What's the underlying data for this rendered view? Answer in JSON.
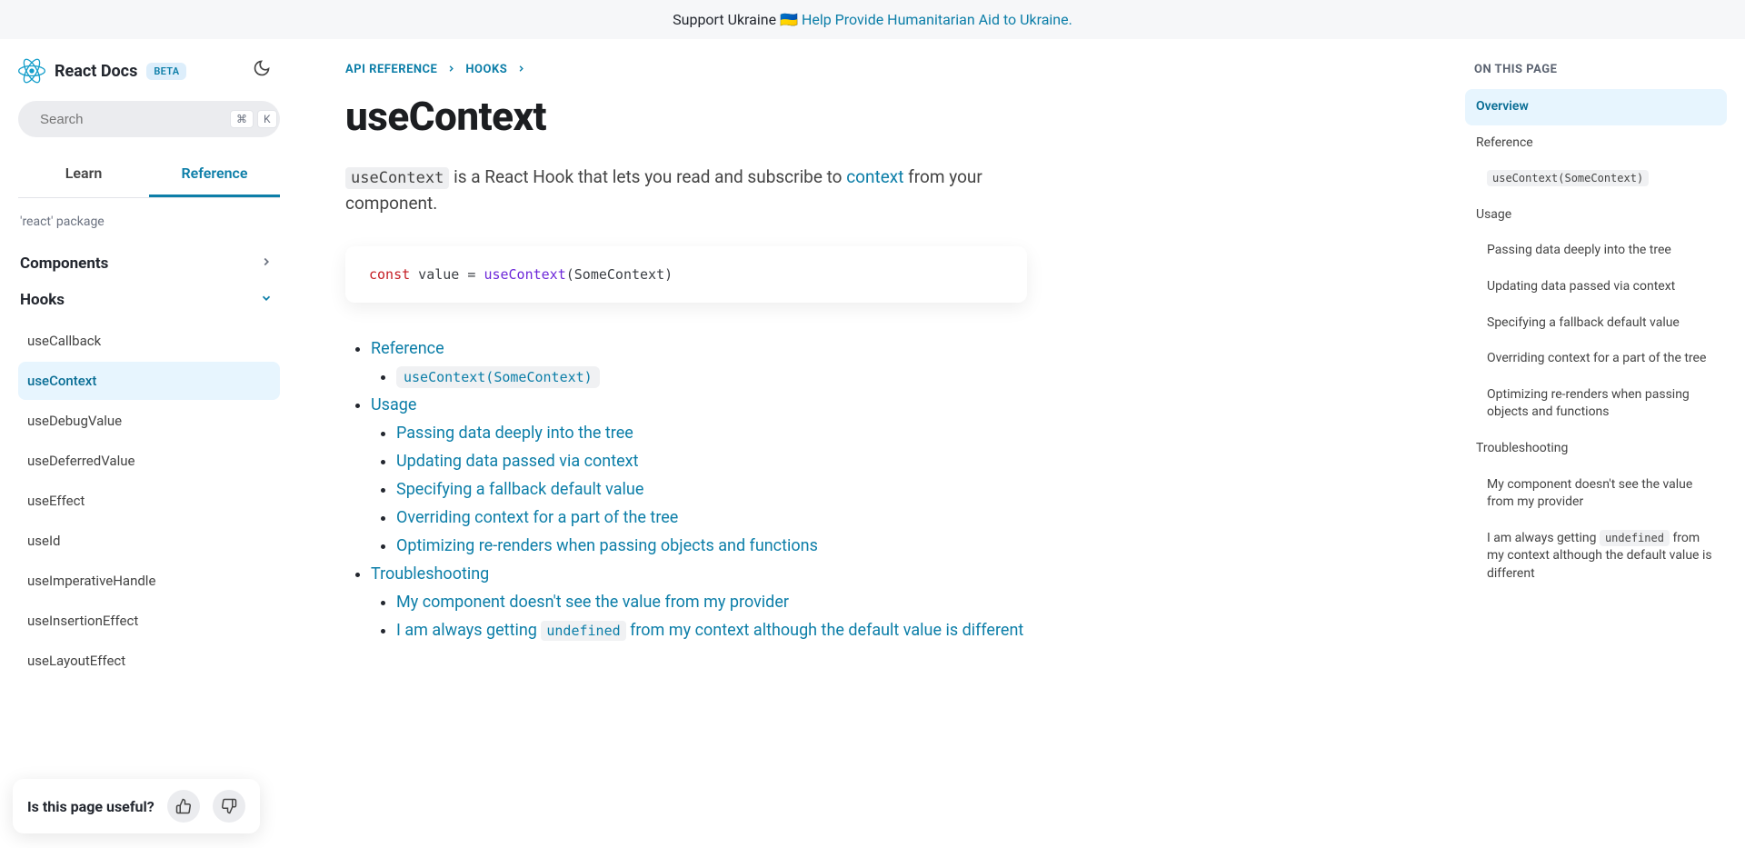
{
  "banner": {
    "text_prefix": "Support Ukraine 🇺🇦 ",
    "link_text": "Help Provide Humanitarian Aid to Ukraine."
  },
  "header": {
    "logo_text": "React Docs",
    "beta_label": "BETA",
    "search_placeholder": "Search",
    "kbd1": "⌘",
    "kbd2": "K"
  },
  "tabs": {
    "learn": "Learn",
    "reference": "Reference"
  },
  "sidebar": {
    "package_label": "'react' package",
    "section_components": "Components",
    "section_hooks": "Hooks",
    "items": [
      "useCallback",
      "useContext",
      "useDebugValue",
      "useDeferredValue",
      "useEffect",
      "useId",
      "useImperativeHandle",
      "useInsertionEffect",
      "useLayoutEffect"
    ]
  },
  "feedback": {
    "question": "Is this page useful?"
  },
  "breadcrumb": {
    "api_reference": "API REFERENCE",
    "hooks": "HOOKS"
  },
  "page": {
    "title": "useContext",
    "intro_code": "useContext",
    "intro_mid": " is a React Hook that lets you read and subscribe to ",
    "intro_link": "context",
    "intro_end": " from your component."
  },
  "code": {
    "kw": "const",
    "var": " value = ",
    "fn": "useContext",
    "rest": "(SomeContext)"
  },
  "toc": {
    "reference": "Reference",
    "ref_code": "useContext(SomeContext)",
    "usage": "Usage",
    "u1": "Passing data deeply into the tree",
    "u2": "Updating data passed via context",
    "u3": "Specifying a fallback default value",
    "u4": "Overriding context for a part of the tree",
    "u5": "Optimizing re-renders when passing objects and functions",
    "troubleshooting": "Troubleshooting",
    "t1": "My component doesn't see the value from my provider",
    "t2_pre": "I am always getting ",
    "t2_code": "undefined",
    "t2_post": " from my context although the default value is different"
  },
  "right_toc": {
    "title": "ON THIS PAGE",
    "overview": "Overview",
    "reference": "Reference",
    "ref_code": "useContext(SomeContext)",
    "usage": "Usage",
    "u1": "Passing data deeply into the tree",
    "u2": "Updating data passed via context",
    "u3": "Specifying a fallback default value",
    "u4": "Overriding context for a part of the tree",
    "u5": "Optimizing re-renders when passing objects and functions",
    "troubleshooting": "Troubleshooting",
    "t1": "My component doesn't see the value from my provider",
    "t2_pre": "I am always getting ",
    "t2_code": "undefined",
    "t2_post": " from my context although the default value is different"
  }
}
